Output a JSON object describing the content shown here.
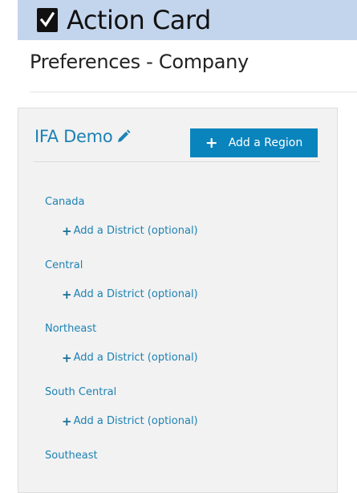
{
  "header": {
    "title": "Action Card",
    "icon": "checkbox-checked-icon",
    "background": "#c3d5ec"
  },
  "page": {
    "subtitle": "Preferences - Company"
  },
  "company": {
    "name": "IFA Demo",
    "edit_icon": "pencil-icon",
    "add_region_label": "Add a Region",
    "add_region_icon": "plus-icon",
    "accent_color": "#0a84bd"
  },
  "regions": [
    {
      "name": "Canada",
      "add_district_label": "Add a District (optional)"
    },
    {
      "name": "Central",
      "add_district_label": "Add a District (optional)"
    },
    {
      "name": "Northeast",
      "add_district_label": "Add a District (optional)"
    },
    {
      "name": "South Central",
      "add_district_label": "Add a District (optional)"
    },
    {
      "name": "Southeast",
      "add_district_label": ""
    }
  ]
}
